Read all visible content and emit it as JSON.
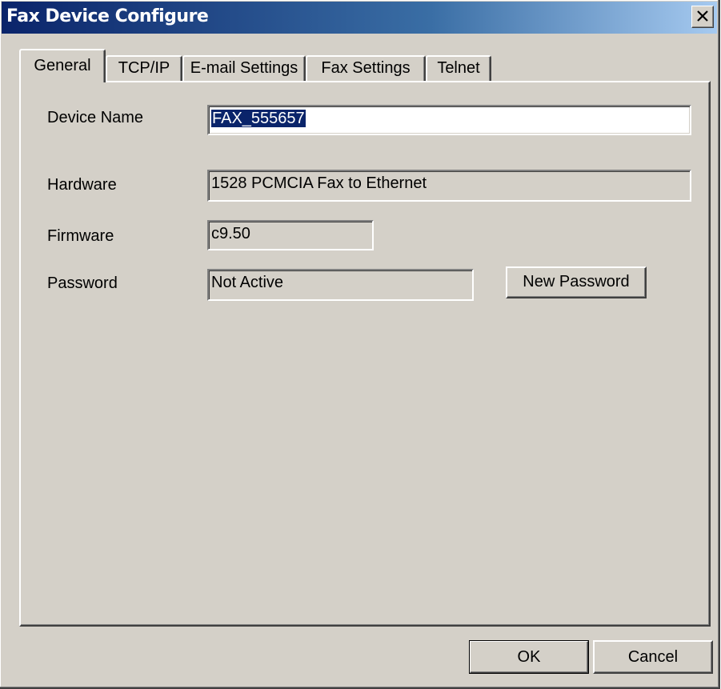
{
  "window": {
    "title": "Fax Device Configure",
    "close_glyph": "×"
  },
  "tabs": [
    {
      "label": "General",
      "active": true
    },
    {
      "label": "TCP/IP",
      "active": false
    },
    {
      "label": "E-mail Settings",
      "active": false
    },
    {
      "label": "Fax Settings",
      "active": false
    },
    {
      "label": "Telnet",
      "active": false
    }
  ],
  "general": {
    "device_name": {
      "label": "Device Name",
      "value": "FAX_555657"
    },
    "hardware": {
      "label": "Hardware",
      "value": "1528 PCMCIA Fax to Ethernet"
    },
    "firmware": {
      "label": "Firmware",
      "value": "c9.50"
    },
    "password": {
      "label": "Password",
      "value": "Not Active"
    },
    "new_password_label": "New Password"
  },
  "footer": {
    "ok_label": "OK",
    "cancel_label": "Cancel"
  },
  "colors": {
    "titlebar_start": "#0a246a",
    "titlebar_end": "#a6caf0",
    "face": "#d4d0c8",
    "selection": "#0a246a"
  }
}
